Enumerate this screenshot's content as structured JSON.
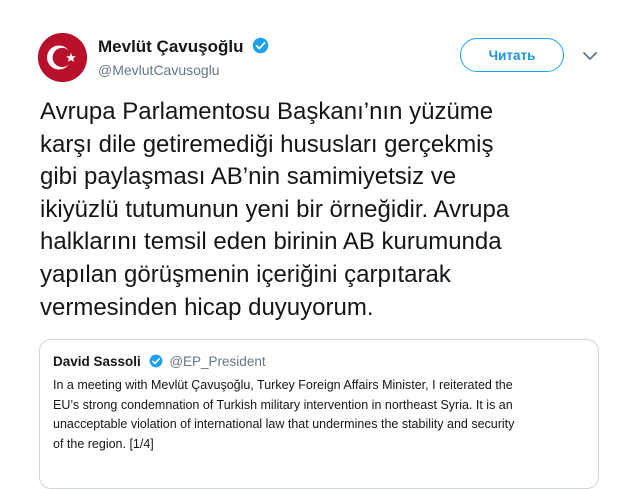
{
  "author": {
    "name": "Mevlüt Çavuşoğlu",
    "handle": "@MevlutCavusoglu",
    "verified": true
  },
  "follow_button_label": "Читать",
  "icons": {
    "avatar": "turkish-flag-avatar",
    "verified": "verified-badge-icon",
    "menu": "chevron-down-icon"
  },
  "colors": {
    "accent": "#1da1f2",
    "avatar_red": "#b8102a",
    "muted_text": "#657786"
  },
  "tweet_lines": [
    "Avrupa Parlamentosu Başkanı’nın yüzüme",
    "karşı dile getiremediği hususları gerçekmiş",
    "gibi paylaşması AB’nin samimiyetsiz ve",
    "ikiyüzlü tutumunun yeni bir örneğidir. Avrupa",
    "halklarını temsil eden birinin AB kurumunda",
    "yapılan görüşmenin içeriğini çarpıtarak",
    "vermesinden hicap duyuyorum."
  ],
  "quoted_tweet": {
    "name": "David Sassoli",
    "handle": "@EP_President",
    "verified": true,
    "lines": [
      "In a meeting with Mevlüt Çavuşoğlu, Turkey Foreign Affairs Minister, I reiterated the",
      "EU’s strong condemnation of Turkish military intervention in northeast Syria. It is an",
      "unacceptable violation of international law that undermines the stability and security",
      "of the region. [1/4]"
    ]
  }
}
